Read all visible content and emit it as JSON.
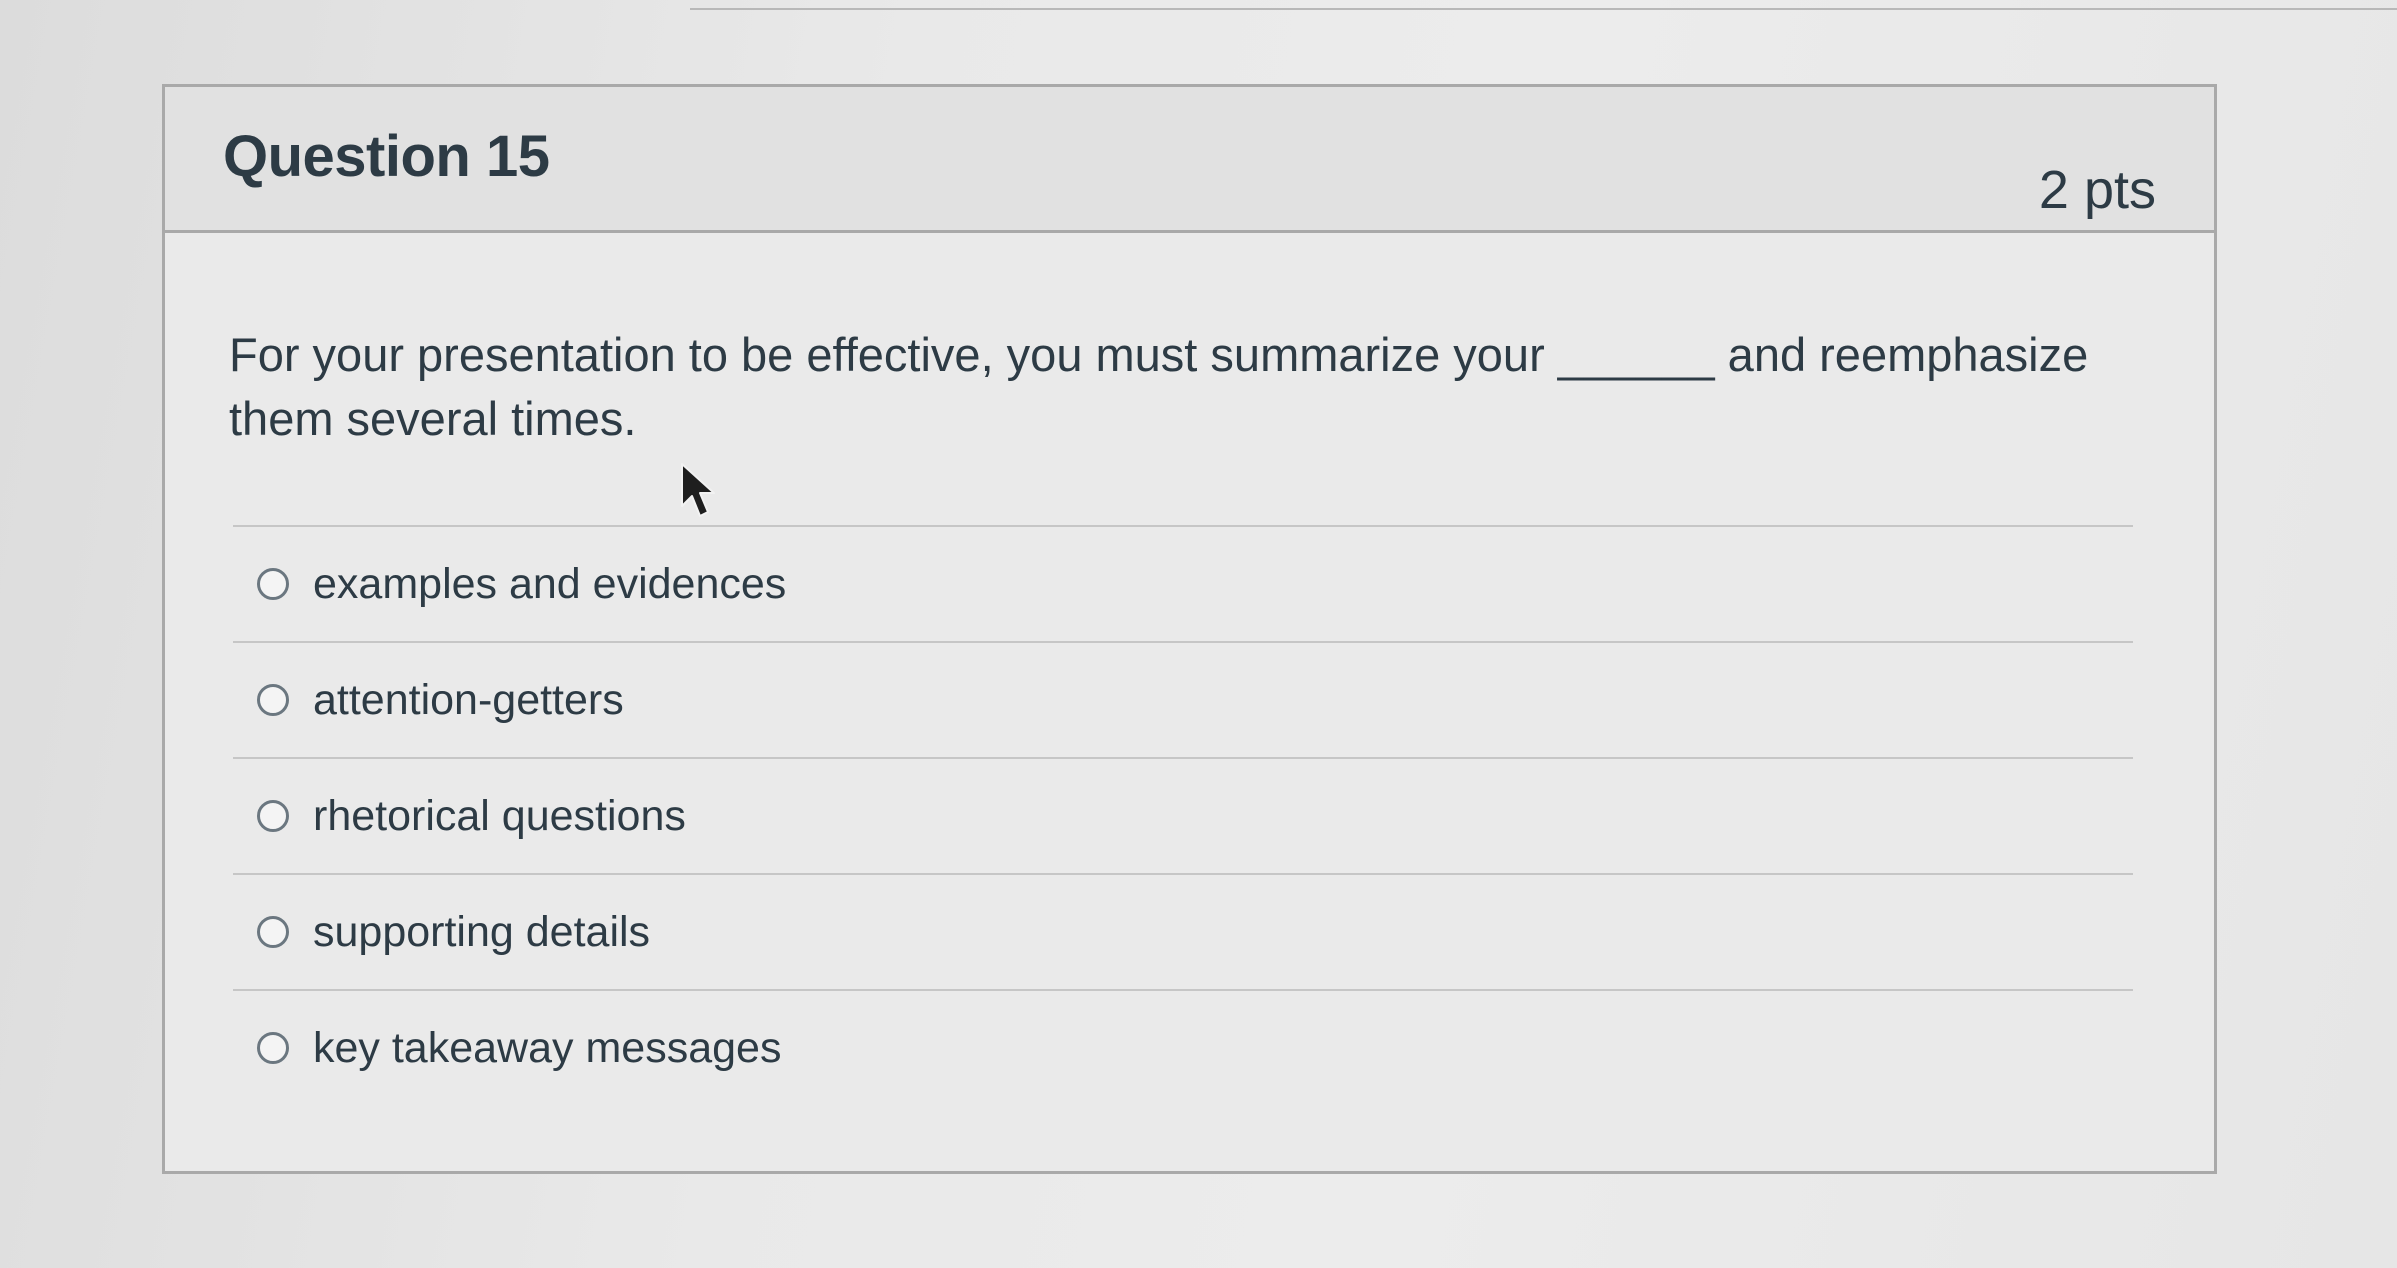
{
  "question": {
    "title": "Question 15",
    "points": "2 pts",
    "text": "For your presentation to be effective, you must summarize your ______ and reemphasize them several times."
  },
  "answers": [
    {
      "label": "examples and evidences",
      "selected": false
    },
    {
      "label": "attention-getters",
      "selected": false
    },
    {
      "label": "rhetorical questions",
      "selected": false
    },
    {
      "label": "supporting details",
      "selected": false
    },
    {
      "label": "key takeaway messages",
      "selected": false
    }
  ],
  "icons": {
    "cursor": "mouse-pointer-icon",
    "radio": "radio-button-icon"
  },
  "colors": {
    "text": "#2d3b45",
    "border": "#a9a9a9",
    "header_bg": "#e1e1e1"
  }
}
